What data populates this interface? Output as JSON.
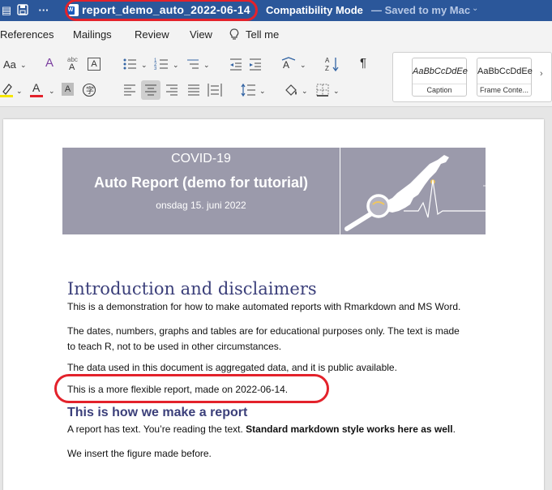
{
  "titlebar": {
    "document_name": "report_demo_auto_2022-06-14",
    "mode": "Compatibility Mode",
    "saved_status": "— Saved to my Mac",
    "more": "···"
  },
  "menu": {
    "tabs": [
      "References",
      "Mailings",
      "Review",
      "View"
    ],
    "tell_me": "Tell me"
  },
  "ribbon": {
    "font_size": "Aa",
    "styles": [
      {
        "sample": "AaBbCcDdEe",
        "name": "Caption"
      },
      {
        "sample": "AaBbCcDdEe",
        "name": "Frame Conte..."
      }
    ]
  },
  "colors": {
    "titlebar": "#2b579a",
    "banner": "#9b9aab",
    "heading": "#3b3f7a",
    "annotation": "#e3222b"
  },
  "document": {
    "banner": {
      "line1": "COVID-19",
      "line2": "Auto Report (demo for tutorial)",
      "line3": "onsdag 15. juni 2022"
    },
    "heading1": "Introduction and disclaimers",
    "para1": "This is a demonstration for how to make automated reports with Rmarkdown and MS Word.",
    "para2_line1": "The dates, numbers, graphs and tables are for educational purposes only. The text is made",
    "para2_line2": "to teach R, not to be used in other circumstances.",
    "para3": "The data used in this document is aggregated data, and it is public available.",
    "para4": "This is a more flexible report, made on 2022-06-14.",
    "heading2": "This is how we make a report",
    "para5_a": "A report has text. You’re reading the text. ",
    "para5_b": "Standard markdown style works here as well",
    "para5_c": ".",
    "para6": "We insert the figure made before."
  }
}
